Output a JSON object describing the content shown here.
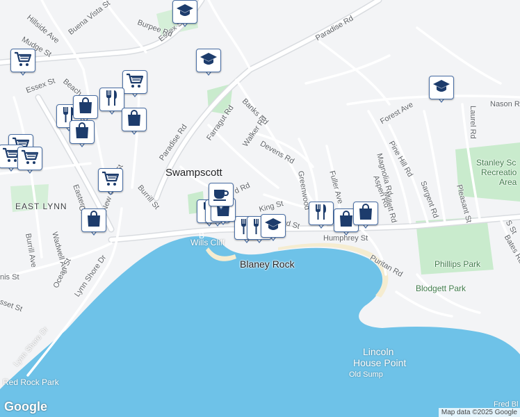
{
  "map": {
    "places": {
      "swampscott": "Swampscott",
      "east_lynn": "EAST LYNN",
      "blaney_rock": "Blaney Rock",
      "wills_cliff": "Wills Cliff",
      "wills_cliff_prefix": "B",
      "lincoln_house_point_1": "Lincoln",
      "lincoln_house_point_2": "House Point",
      "old_sump": "Old Sump"
    },
    "parks": {
      "red_rock": "Red Rock Park",
      "phillips": "Phillips Park",
      "blodgett": "Blodgett Park",
      "stanley_1": "Stanley Sc",
      "stanley_2": "Recreatio",
      "stanley_3": "Area"
    },
    "streets": {
      "paradise_rd_ne": "Paradise Rd",
      "paradise_rd_sw": "Paradise Rd",
      "essex_st_top": "Essex St",
      "essex_st_left": "Essex St",
      "burpee_rd": "Burpee Rd",
      "buena_vista": "Buena Vista St",
      "hillside_ave": "Hillside Ave",
      "mudge_st": "Mudge St",
      "beach": "Beach",
      "banks_rd": "Banks Rd",
      "farragut_rd": "Farragut Rd",
      "walker_rd": "Walker Rd",
      "devens_rd": "Devens Rd",
      "greenwood": "Greenwood",
      "fuller_ave": "Fuller Ave",
      "forest_ave": "Forest Ave",
      "nason": "Nason R",
      "laurel_rd": "Laurel Rd",
      "pine_hill_rd": "Pine Hill Rd",
      "magnolia_rd": "Magnolia Rd",
      "aspen_rd": "Aspen Rd",
      "millett_rd": "Millett Rd",
      "sargent_rd": "Sargent Rd",
      "pleasant_st": "Pleasant St",
      "bates_rd": "Bates Rd",
      "s_st": "S St",
      "humphrey_st": "Humphrey St",
      "puritan_rd": "Puritan Rd",
      "king_st": "King St",
      "and_st": "and St",
      "d_rd": "d Rd",
      "burrill_st": "Burrill St",
      "new_ocean_st": "New Ocean St",
      "eastern_a": "Eastern A",
      "or": "Or",
      "wadwell": "Wadwell Ave",
      "burrill_ave": "Burrill Ave",
      "ocean_st": "Ocean St",
      "lynn_shore_dr_1": "Lynn Shore Dr",
      "lynn_shore_dr_2": "Lynn Shore Dr",
      "nis_st": "nis St",
      "sset_st": "sset St",
      "fred_bl": "Fred Bl"
    },
    "attribution": "Map data ©2025 Google",
    "logo": "Google"
  },
  "colors": {
    "land": "#f3f4f6",
    "water": "#6ec2e8",
    "park": "#c9ebcd",
    "road": "#ffffff",
    "road_edge": "#d5d8dc",
    "pin_border": "#4a6fa5",
    "pin_icon": "#1d3c6c"
  },
  "pins": [
    {
      "type": "grocery"
    },
    {
      "type": "grocery"
    },
    {
      "type": "grocery"
    },
    {
      "type": "grocery"
    },
    {
      "type": "grocery"
    },
    {
      "type": "grocery"
    },
    {
      "type": "restaurant"
    },
    {
      "type": "restaurant"
    },
    {
      "type": "restaurant"
    },
    {
      "type": "restaurant"
    },
    {
      "type": "restaurant"
    },
    {
      "type": "restaurant"
    },
    {
      "type": "restaurant"
    },
    {
      "type": "shopping"
    },
    {
      "type": "shopping"
    },
    {
      "type": "shopping"
    },
    {
      "type": "shopping"
    },
    {
      "type": "shopping"
    },
    {
      "type": "shopping"
    },
    {
      "type": "shopping"
    },
    {
      "type": "school"
    },
    {
      "type": "school"
    },
    {
      "type": "school"
    },
    {
      "type": "school"
    },
    {
      "type": "cafe"
    }
  ]
}
